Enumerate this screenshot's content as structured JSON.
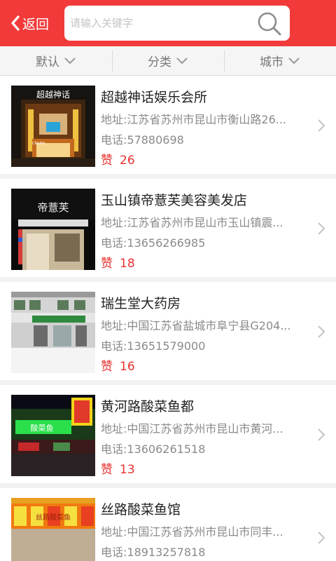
{
  "header": {
    "back_label": "返回",
    "search_placeholder": "请输入关键字",
    "accent_color": "#f23a3a"
  },
  "filters": [
    {
      "label": "默认"
    },
    {
      "label": "分类"
    },
    {
      "label": "城市"
    }
  ],
  "listings": [
    {
      "name": "超越神话娱乐会所",
      "address": "地址:江苏省苏州市昆山市衡山路26...",
      "phone": "电话:57880698",
      "likes_label": "赞",
      "likes": "26",
      "sign_text": "超越神话",
      "sign_subtext": "CRIVEA"
    },
    {
      "name": "玉山镇帝薏芙美容美发店",
      "address": "地址:江苏省苏州市昆山市玉山镇震...",
      "phone": "电话:13656266985",
      "likes_label": "赞",
      "likes": "18",
      "sign_text": "帝薏芙"
    },
    {
      "name": "瑞生堂大药房",
      "address": "地址:中国江苏省盐城市阜宁县G204...",
      "phone": "电话:13651579000",
      "likes_label": "赞",
      "likes": "16"
    },
    {
      "name": "黄河路酸菜鱼都",
      "address": "地址:中国江苏省苏州市昆山市黄河...",
      "phone": "电话:13606261518",
      "likes_label": "赞",
      "likes": "13",
      "sign_text": "酸菜鱼"
    },
    {
      "name": "丝路酸菜鱼馆",
      "address": "地址:中国江苏省苏州市昆山市同丰...",
      "phone": "电话:18913257818",
      "likes_label": "赞",
      "likes": "",
      "sign_text": "丝路酸菜鱼"
    }
  ]
}
